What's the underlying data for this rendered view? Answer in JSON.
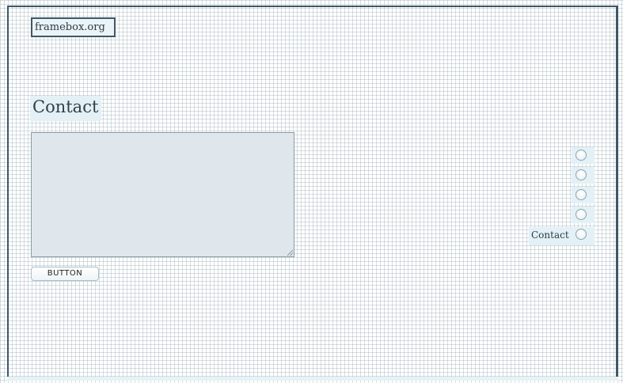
{
  "site": {
    "logo_text": "framebox.org"
  },
  "form": {
    "title": "Contact",
    "message_value": "",
    "button_label": "BUTTON"
  },
  "options": {
    "items": [
      {
        "label": "",
        "selected": false
      },
      {
        "label": "",
        "selected": false
      },
      {
        "label": "",
        "selected": false
      },
      {
        "label": "",
        "selected": false
      },
      {
        "label": "Contact",
        "selected": false
      }
    ]
  },
  "colors": {
    "frame_border": "#3f5866",
    "highlight_bg": "#e3f1f6",
    "textarea_bg": "#dfe7ed",
    "grid_line": "#8ca0aa"
  }
}
